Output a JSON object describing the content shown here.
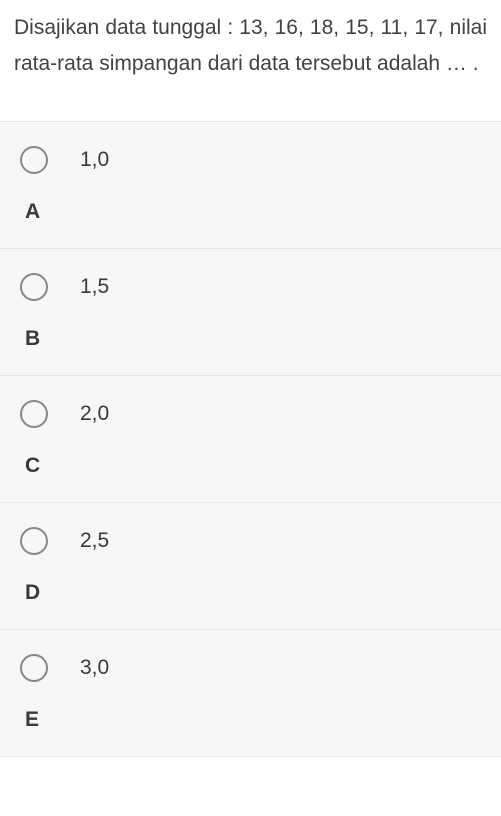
{
  "question": "Disajikan data tunggal : 13, 16, 18, 15, 11, 17, nilai rata-rata simpangan dari data tersebut adalah … .",
  "options": [
    {
      "letter": "A",
      "value": "1,0"
    },
    {
      "letter": "B",
      "value": "1,5"
    },
    {
      "letter": "C",
      "value": "2,0"
    },
    {
      "letter": "D",
      "value": "2,5"
    },
    {
      "letter": "E",
      "value": "3,0"
    }
  ]
}
